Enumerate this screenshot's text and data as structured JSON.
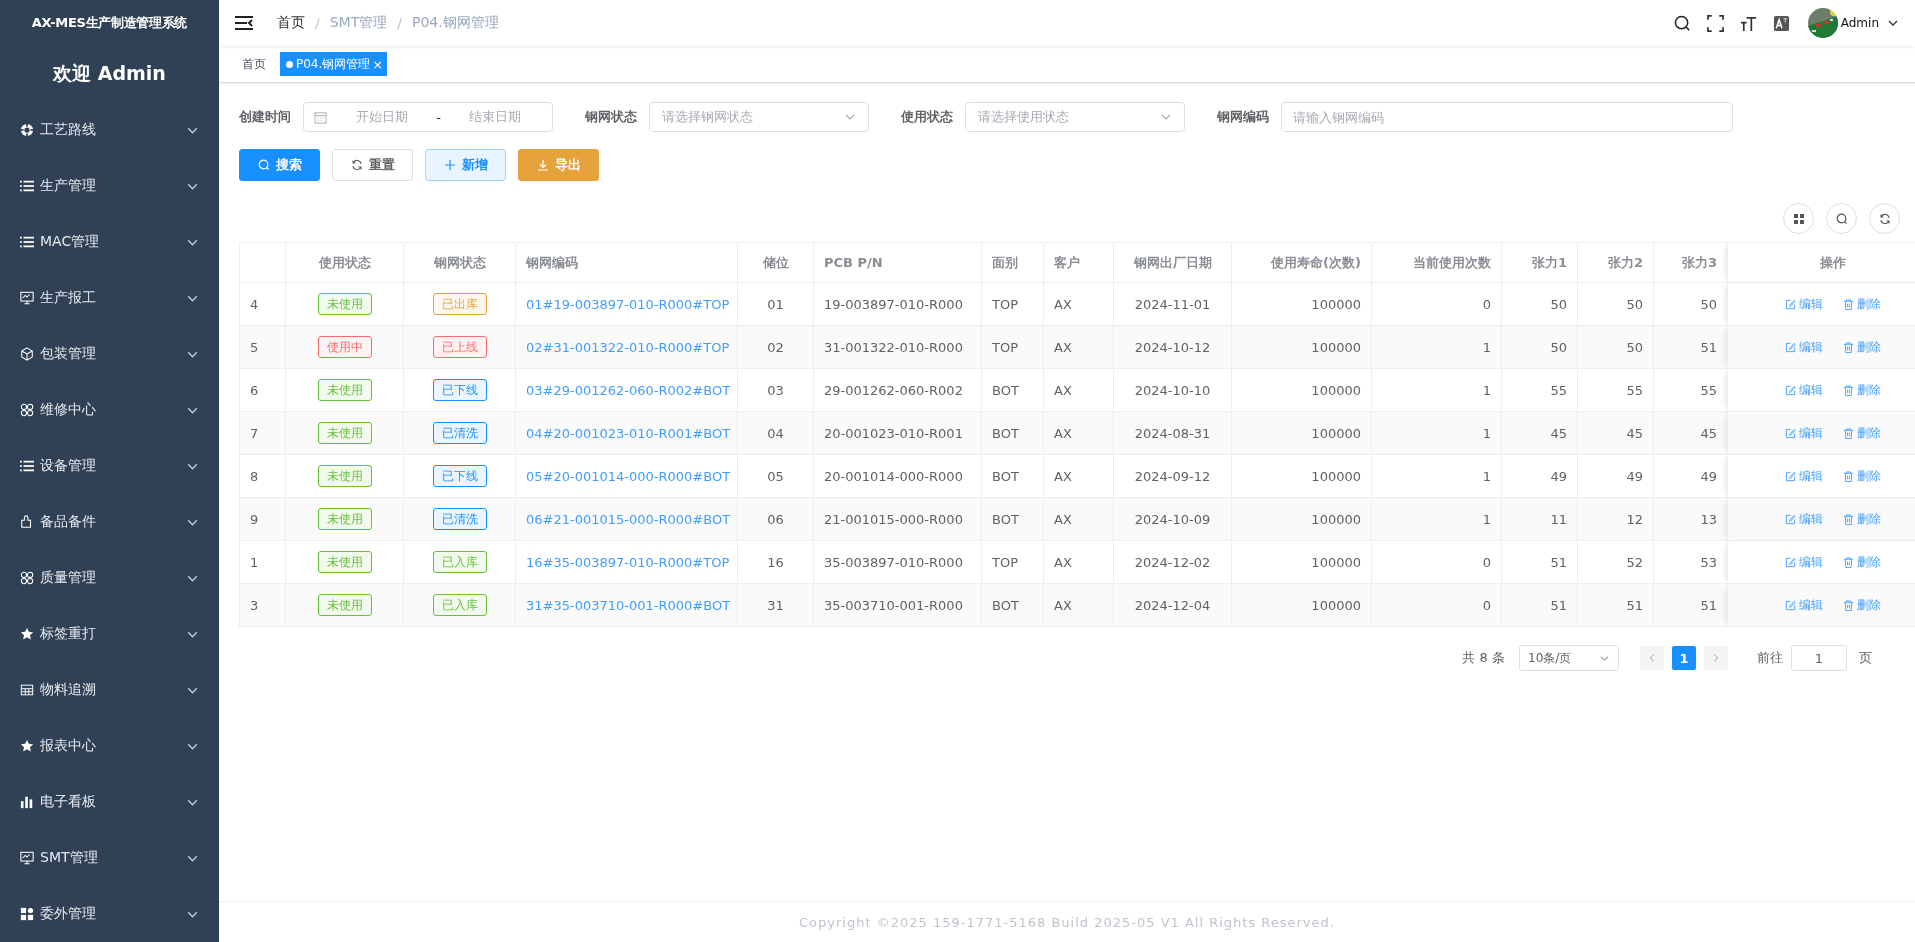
{
  "app_title": "AX-MES生产制造管理系统",
  "welcome": "欢迎 Admin",
  "sidebar": {
    "items": [
      {
        "label": "工艺路线",
        "expanded": false
      },
      {
        "label": "生产管理",
        "expanded": false
      },
      {
        "label": "MAC管理",
        "expanded": false
      },
      {
        "label": "生产报工",
        "expanded": false
      },
      {
        "label": "包装管理",
        "expanded": false
      },
      {
        "label": "维修中心",
        "expanded": false
      },
      {
        "label": "设备管理",
        "expanded": false
      },
      {
        "label": "备品备件",
        "expanded": false
      },
      {
        "label": "质量管理",
        "expanded": false
      },
      {
        "label": "标签重打",
        "expanded": false
      },
      {
        "label": "物料追溯",
        "expanded": false
      },
      {
        "label": "报表中心",
        "expanded": false
      },
      {
        "label": "电子看板",
        "expanded": false
      },
      {
        "label": "SMT管理",
        "expanded": false
      },
      {
        "label": "委外管理",
        "expanded": false
      }
    ]
  },
  "breadcrumb": [
    {
      "text": "首页",
      "kind": "link"
    },
    {
      "text": "/",
      "kind": "separator"
    },
    {
      "text": "SMT管理",
      "kind": "link"
    },
    {
      "text": "/",
      "kind": "separator"
    },
    {
      "text": "P04.钢网管理",
      "kind": "current"
    }
  ],
  "user": {
    "name": "Admin"
  },
  "tabs": [
    {
      "label": "首页",
      "selected": false
    },
    {
      "label": "P04.钢网管理",
      "selected": true,
      "close": "×"
    }
  ],
  "filters": {
    "created_label": "创建时间",
    "start_placeholder": "开始日期",
    "range_separator": "-",
    "end_placeholder": "结束日期",
    "fields": [
      {
        "label": "钢网状态",
        "placeholder": "请选择钢网状态",
        "kind": "select"
      },
      {
        "label": "使用状态",
        "placeholder": "请选择使用状态",
        "kind": "select"
      },
      {
        "label": "钢网编码",
        "placeholder": "请输入钢网编码",
        "kind": "input"
      }
    ]
  },
  "actions": [
    {
      "label": "搜索",
      "kind": "primary"
    },
    {
      "label": "重置",
      "kind": "default"
    },
    {
      "label": "新增",
      "kind": "plain"
    },
    {
      "label": "导出",
      "kind": "warning"
    }
  ],
  "table": {
    "columns": [
      "",
      "使用状态",
      "钢网状态",
      "钢网编码",
      "储位",
      "PCB P/N",
      "面别",
      "客户",
      "钢网出厂日期",
      "使用寿命(次数)",
      "当前使用次数",
      "张力1",
      "张力2",
      "张力3",
      "操作"
    ],
    "rows": [
      {
        "index": "4",
        "usage": {
          "text": "未使用",
          "color": "#67c23a"
        },
        "status": {
          "text": "已出库",
          "color": "#e6a23c"
        },
        "code": "01#19-003897-010-R000#TOP",
        "slot": "01",
        "pcb": "19-003897-010-R000",
        "side": "TOP",
        "customer": "AX",
        "date": "2024-11-01",
        "life": "100000",
        "used": "0",
        "t1": "50",
        "t2": "50",
        "t3": "50",
        "actions": [
          "编辑",
          "删除"
        ]
      },
      {
        "index": "5",
        "usage": {
          "text": "使用中",
          "color": "#f56c6c"
        },
        "status": {
          "text": "已上线",
          "color": "#f56c6c"
        },
        "code": "02#31-001322-010-R000#TOP",
        "slot": "02",
        "pcb": "31-001322-010-R000",
        "side": "TOP",
        "customer": "AX",
        "date": "2024-10-12",
        "life": "100000",
        "used": "1",
        "t1": "50",
        "t2": "50",
        "t3": "51",
        "actions": [
          "编辑",
          "删除"
        ]
      },
      {
        "index": "6",
        "usage": {
          "text": "未使用",
          "color": "#67c23a"
        },
        "status": {
          "text": "已下线",
          "color": "#1890ff"
        },
        "code": "03#29-001262-060-R002#BOT",
        "slot": "03",
        "pcb": "29-001262-060-R002",
        "side": "BOT",
        "customer": "AX",
        "date": "2024-10-10",
        "life": "100000",
        "used": "1",
        "t1": "55",
        "t2": "55",
        "t3": "55",
        "actions": [
          "编辑",
          "删除"
        ]
      },
      {
        "index": "7",
        "usage": {
          "text": "未使用",
          "color": "#67c23a"
        },
        "status": {
          "text": "已清洗",
          "color": "#1890ff"
        },
        "code": "04#20-001023-010-R001#BOT",
        "slot": "04",
        "pcb": "20-001023-010-R001",
        "side": "BOT",
        "customer": "AX",
        "date": "2024-08-31",
        "life": "100000",
        "used": "1",
        "t1": "45",
        "t2": "45",
        "t3": "45",
        "actions": [
          "编辑",
          "删除"
        ]
      },
      {
        "index": "8",
        "usage": {
          "text": "未使用",
          "color": "#67c23a"
        },
        "status": {
          "text": "已下线",
          "color": "#1890ff"
        },
        "code": "05#20-001014-000-R000#BOT",
        "slot": "05",
        "pcb": "20-001014-000-R000",
        "side": "BOT",
        "customer": "AX",
        "date": "2024-09-12",
        "life": "100000",
        "used": "1",
        "t1": "49",
        "t2": "49",
        "t3": "49",
        "actions": [
          "编辑",
          "删除"
        ]
      },
      {
        "index": "9",
        "usage": {
          "text": "未使用",
          "color": "#67c23a"
        },
        "status": {
          "text": "已清洗",
          "color": "#1890ff"
        },
        "code": "06#21-001015-000-R000#BOT",
        "slot": "06",
        "pcb": "21-001015-000-R000",
        "side": "BOT",
        "customer": "AX",
        "date": "2024-10-09",
        "life": "100000",
        "used": "1",
        "t1": "11",
        "t2": "12",
        "t3": "13",
        "actions": [
          "编辑",
          "删除"
        ]
      },
      {
        "index": "1",
        "usage": {
          "text": "未使用",
          "color": "#67c23a"
        },
        "status": {
          "text": "已入库",
          "color": "#67c23a"
        },
        "code": "16#35-003897-010-R000#TOP",
        "slot": "16",
        "pcb": "35-003897-010-R000",
        "side": "TOP",
        "customer": "AX",
        "date": "2024-12-02",
        "life": "100000",
        "used": "0",
        "t1": "51",
        "t2": "52",
        "t3": "53",
        "actions": [
          "编辑",
          "删除"
        ]
      },
      {
        "index": "3",
        "usage": {
          "text": "未使用",
          "color": "#67c23a"
        },
        "status": {
          "text": "已入库",
          "color": "#67c23a"
        },
        "code": "31#35-003710-001-R000#BOT",
        "slot": "31",
        "pcb": "35-003710-001-R000",
        "side": "BOT",
        "customer": "AX",
        "date": "2024-12-04",
        "life": "100000",
        "used": "0",
        "t1": "51",
        "t2": "51",
        "t3": "51",
        "actions": [
          "编辑",
          "删除"
        ]
      }
    ]
  },
  "pagination": {
    "total": "共 8 条",
    "page_size": "10条/页",
    "pages": [
      {
        "label": "1",
        "selected": true
      }
    ],
    "goto_label": "前往",
    "goto_value": "1",
    "page_suffix": "页"
  },
  "footer": "Copyright ©2025 159-1771-5168 Build 2025-05 V1 All Rights Reserved."
}
